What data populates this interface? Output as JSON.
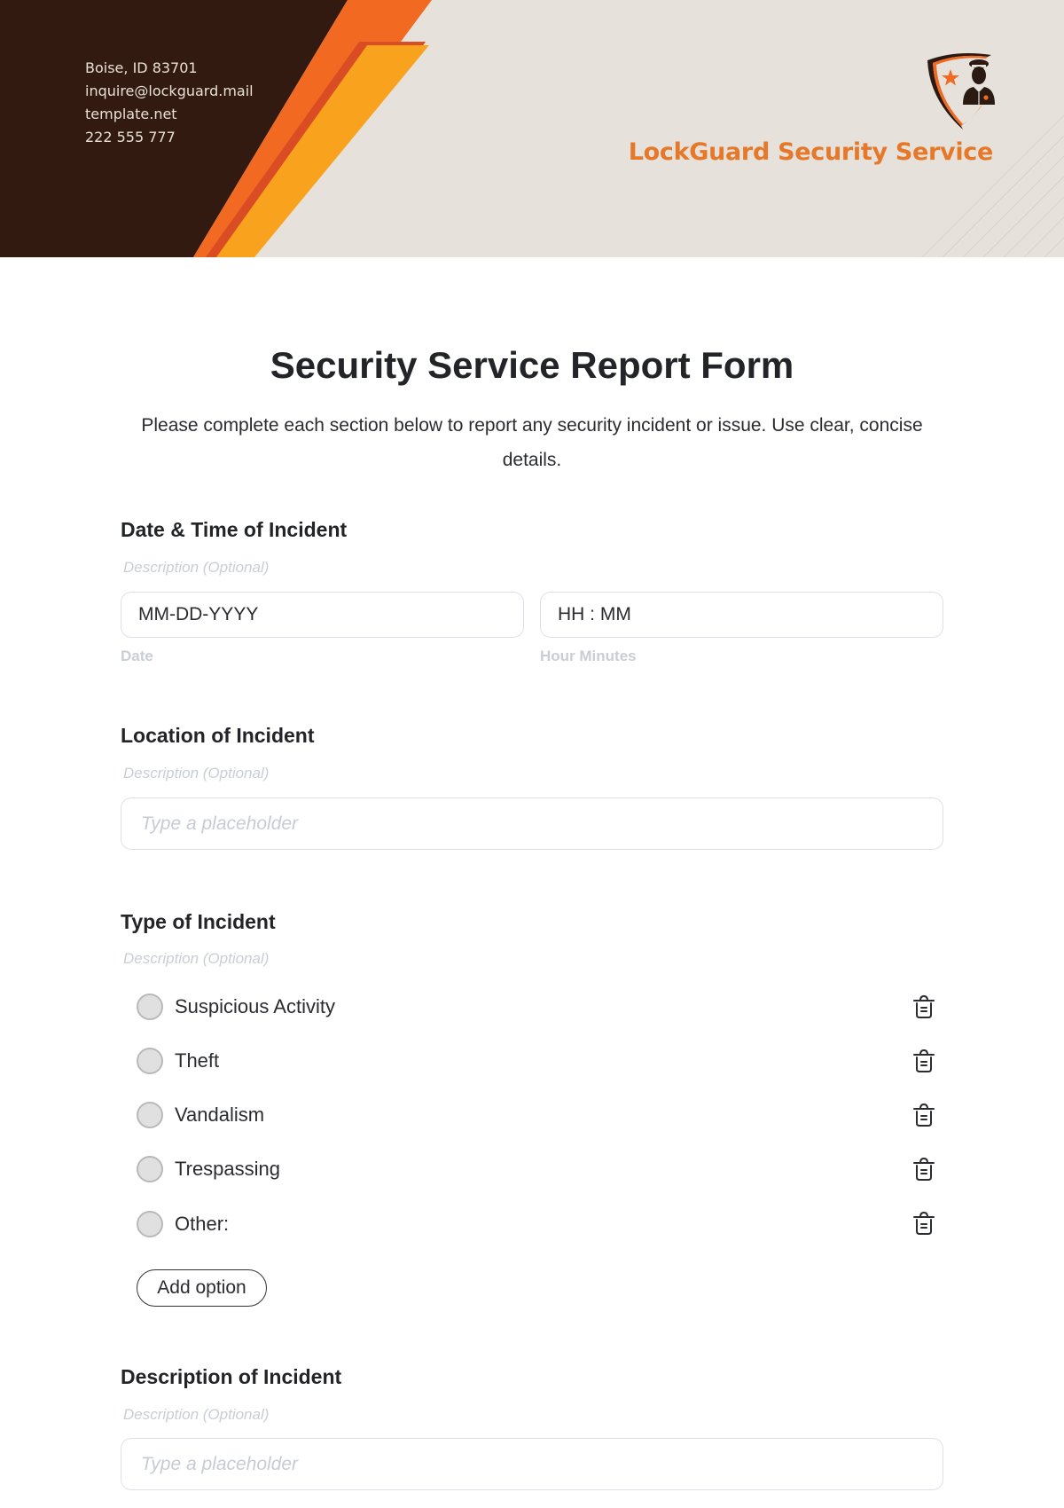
{
  "header": {
    "contact": {
      "address": "Boise, ID 83701",
      "email": "inquire@lockguard.mail",
      "website": "template.net",
      "phone": "222 555 777"
    },
    "brand_name": "LockGuard Security Service",
    "logo_icon": "security-guard-shield-icon",
    "colors": {
      "dark_brown": "#321a10",
      "orange": "#f26a22",
      "red_orange": "#d94c24",
      "yellow": "#f8a21e",
      "beige": "#e6e2db",
      "brand_text": "#e6782a"
    }
  },
  "form": {
    "title": "Security Service Report Form",
    "subtitle": "Please complete each section below to report any security incident or issue. Use clear, concise details.",
    "sections": {
      "datetime": {
        "title": "Date & Time of Incident",
        "description": "Description (Optional)",
        "date_field": {
          "value": "MM-DD-YYYY",
          "sublabel": "Date"
        },
        "time_field": {
          "value": "HH : MM",
          "sublabel": "Hour Minutes"
        }
      },
      "location": {
        "title": "Location of Incident",
        "description": "Description (Optional)",
        "placeholder": "Type a placeholder"
      },
      "type": {
        "title": "Type of Incident",
        "description": "Description (Optional)",
        "options": [
          {
            "label": "Suspicious Activity",
            "selected": false
          },
          {
            "label": "Theft",
            "selected": false
          },
          {
            "label": "Vandalism",
            "selected": false
          },
          {
            "label": "Trespassing",
            "selected": false
          },
          {
            "label": "Other:",
            "selected": false
          }
        ],
        "add_option_label": "Add option",
        "delete_icon": "trash-icon"
      },
      "description": {
        "title": "Description of Incident",
        "description": "Description (Optional)",
        "placeholder": "Type a placeholder"
      }
    }
  }
}
